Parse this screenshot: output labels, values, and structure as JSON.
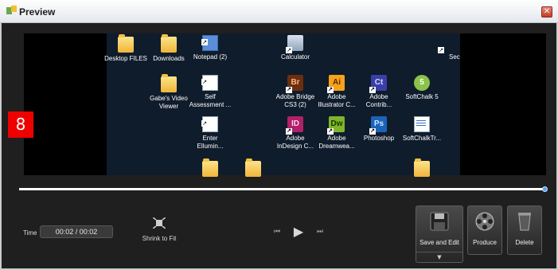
{
  "window": {
    "title": "Preview",
    "close_glyph": "✕"
  },
  "overlay_number": "8",
  "desktop_icons": [
    {
      "label": "Desktop FILES",
      "icon": "folder-icon"
    },
    {
      "label": "Downloads",
      "icon": "folder-icon"
    },
    {
      "label": "Notepad (2)",
      "icon": "notepad-icon"
    },
    {
      "label": "Calculator",
      "icon": "calculator-icon"
    },
    {
      "label": "Sec",
      "icon": "shortcut-icon"
    },
    {
      "label": "Gabe's Video Viewer",
      "icon": "folder-icon"
    },
    {
      "label": "Self Assessment ...",
      "icon": "word-doc-icon"
    },
    {
      "label": "Adobe Bridge CS3 (2)",
      "icon": "adobe-bridge-icon",
      "glyph": "Br",
      "color": "#6b2f10"
    },
    {
      "label": "Adobe Illustrator C...",
      "icon": "adobe-illustrator-icon",
      "glyph": "Ai",
      "color": "#f7a21b"
    },
    {
      "label": "Adobe Contrib...",
      "icon": "adobe-contribute-icon",
      "glyph": "Ct",
      "color": "#3a3fa8"
    },
    {
      "label": "SoftChalk 5",
      "icon": "softchalk-icon",
      "glyph": "5",
      "color": "#8bc34a"
    },
    {
      "label": "Enter Ellumin...",
      "icon": "word-doc-icon"
    },
    {
      "label": "Adobe InDesign C...",
      "icon": "adobe-indesign-icon",
      "glyph": "ID",
      "color": "#b0206b"
    },
    {
      "label": "Adobe Dreamwea...",
      "icon": "adobe-dreamweaver-icon",
      "glyph": "Dw",
      "color": "#7fb52a"
    },
    {
      "label": "Photoshop",
      "icon": "photoshop-icon",
      "glyph": "Ps",
      "color": "#1a64b8"
    },
    {
      "label": "SoftChalkTr...",
      "icon": "softchalk-doc-icon"
    }
  ],
  "playback": {
    "progress": 1.0
  },
  "controls": {
    "time_label": "Time",
    "time_value": "00:02  /  00:02",
    "shrink_label": "Shrink to Fit",
    "rewind_glyph": "⏮",
    "play_glyph": "▶",
    "ffwd_glyph": "⏭",
    "save_label": "Save and Edit",
    "save_caret": "▼",
    "produce_label": "Produce",
    "delete_label": "Delete"
  },
  "colors": {
    "accent": "#4aa3ff",
    "overlay": "#ee0000",
    "close": "#c43b24"
  }
}
